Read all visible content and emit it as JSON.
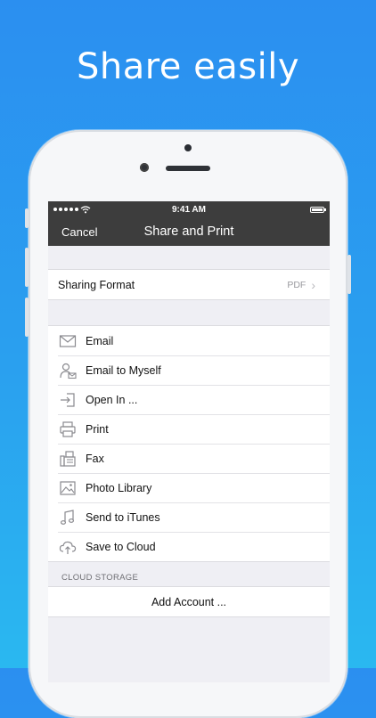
{
  "headline": "Share easily",
  "status_bar": {
    "time": "9:41 AM"
  },
  "nav": {
    "cancel": "Cancel",
    "title": "Share and Print"
  },
  "sharing_format": {
    "label": "Sharing Format",
    "value": "PDF"
  },
  "actions": [
    {
      "label": "Email",
      "icon": "envelope-icon"
    },
    {
      "label": "Email to Myself",
      "icon": "person-mail-icon"
    },
    {
      "label": "Open In ...",
      "icon": "open-in-icon"
    },
    {
      "label": "Print",
      "icon": "printer-icon"
    },
    {
      "label": "Fax",
      "icon": "fax-icon"
    },
    {
      "label": "Photo Library",
      "icon": "photo-icon"
    },
    {
      "label": "Send to iTunes",
      "icon": "music-note-icon"
    },
    {
      "label": "Save to Cloud",
      "icon": "cloud-upload-icon"
    }
  ],
  "cloud_storage": {
    "section_label": "CLOUD STORAGE",
    "add_account": "Add Account ..."
  },
  "colors": {
    "bar": "#3d3d3d",
    "background_top": "#2b8ff0",
    "background_bottom": "#2ab8f0",
    "icon": "#8a8a8f"
  }
}
